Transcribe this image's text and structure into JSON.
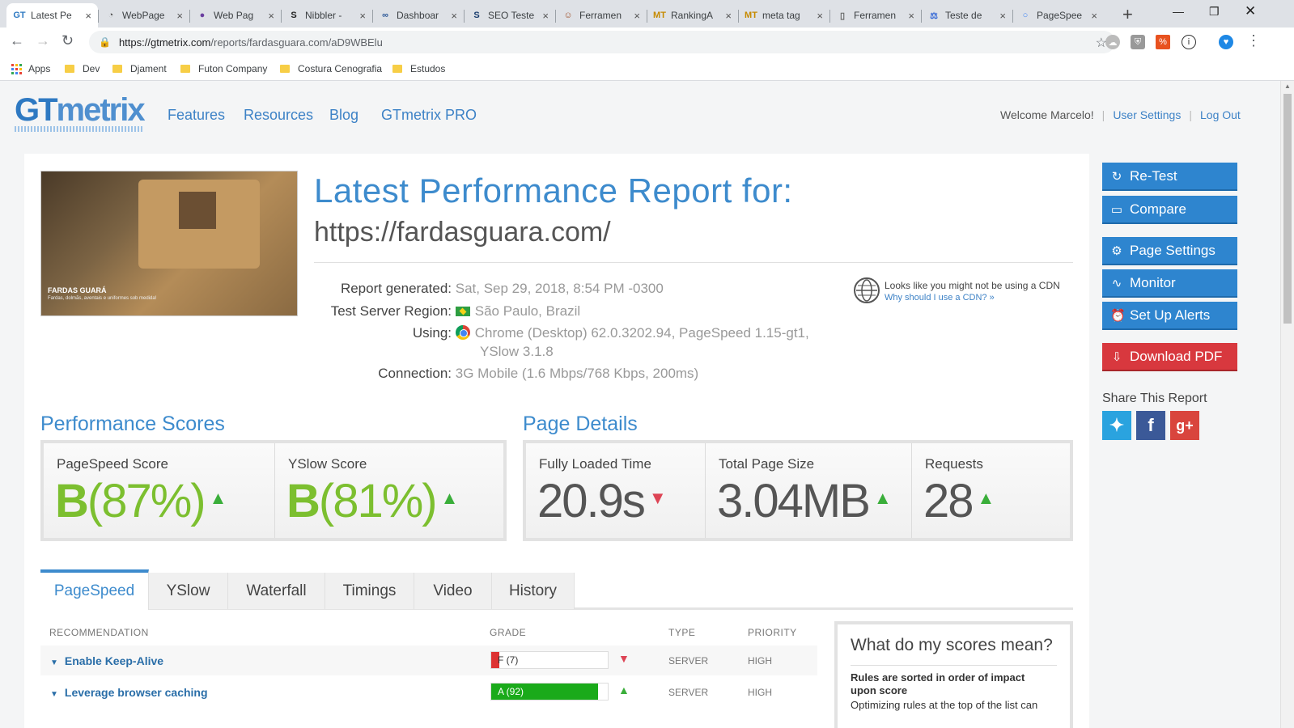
{
  "browser": {
    "tabs": [
      {
        "label": "Latest Pe",
        "favicon": "GT",
        "fav_color": "#2e79c2"
      },
      {
        "label": "WebPage",
        "favicon": "◔",
        "fav_color": "#555"
      },
      {
        "label": "Web Pag",
        "favicon": "●",
        "fav_color": "#6b3fa0"
      },
      {
        "label": "Nibbler -",
        "favicon": "S",
        "fav_color": "#222"
      },
      {
        "label": "Dashboar",
        "favicon": "∞",
        "fav_color": "#2b5797"
      },
      {
        "label": "SEO Teste",
        "favicon": "S",
        "fav_color": "#1a3d6e"
      },
      {
        "label": "Ferramen",
        "favicon": "☺",
        "fav_color": "#a0522d"
      },
      {
        "label": "RankingA",
        "favicon": "MT",
        "fav_color": "#c68a00"
      },
      {
        "label": "meta tag",
        "favicon": "MT",
        "fav_color": "#c68a00"
      },
      {
        "label": "Ferramen",
        "favicon": "▯",
        "fav_color": "#666"
      },
      {
        "label": "Teste de",
        "favicon": "⚖",
        "fav_color": "#3367d6"
      },
      {
        "label": "PageSpee",
        "favicon": "○",
        "fav_color": "#4285f4"
      }
    ],
    "close_glyph": "×",
    "new_tab": "+",
    "url_host": "https://gtmetrix.com",
    "url_path": "/reports/fardasguara.com/aD9WBElu",
    "bookmarks": [
      "Apps",
      "Dev",
      "Djament",
      "Futon Company",
      "Costura Cenografia",
      "Estudos"
    ]
  },
  "header": {
    "logo_gt": "GT",
    "logo_rest": "metrix",
    "nav": [
      "Features",
      "Resources",
      "Blog",
      "GTmetrix PRO"
    ],
    "welcome": "Welcome Marcelo!",
    "user_settings": "User Settings",
    "logout": "Log Out"
  },
  "screenshot": {
    "brand": "FARDAS GUARÁ",
    "tagline": "Fardas, dolmãs, aventais e uniformes sob medida!"
  },
  "report": {
    "title": "Latest Performance Report for:",
    "url": "https://fardasguara.com/",
    "generated_label": "Report generated:",
    "generated_value": "Sat, Sep 29, 2018, 8:54 PM -0300",
    "region_label": "Test Server Region:",
    "region_value": "São Paulo, Brazil",
    "using_label": "Using:",
    "using_value_1": "Chrome (Desktop) 62.0.3202.94, PageSpeed 1.15-gt1,",
    "using_value_2": "YSlow 3.1.8",
    "connection_label": "Connection:",
    "connection_value": "3G Mobile (1.6 Mbps/768 Kbps, 200ms)",
    "cdn_text": "Looks like you might not be using a CDN",
    "cdn_link": "Why should I use a CDN? »"
  },
  "performance": {
    "title": "Performance Scores",
    "pagespeed_label": "PageSpeed Score",
    "pagespeed_grade": "B",
    "pagespeed_pct": "(87%)",
    "yslow_label": "YSlow Score",
    "yslow_grade": "B",
    "yslow_pct": "(81%)"
  },
  "details": {
    "title": "Page Details",
    "loaded_label": "Fully Loaded Time",
    "loaded_value": "20.9s",
    "size_label": "Total Page Size",
    "size_value": "3.04MB",
    "requests_label": "Requests",
    "requests_value": "28"
  },
  "report_tabs": [
    "PageSpeed",
    "YSlow",
    "Waterfall",
    "Timings",
    "Video",
    "History"
  ],
  "table": {
    "headers": [
      "RECOMMENDATION",
      "GRADE",
      "TYPE",
      "PRIORITY"
    ],
    "rows": [
      {
        "name": "Enable Keep-Alive",
        "grade_text": "F (7)",
        "score": 7,
        "color": "#dd3333",
        "trend": "down",
        "type": "SERVER",
        "priority": "HIGH"
      },
      {
        "name": "Leverage browser caching",
        "grade_text": "A (92)",
        "score": 92,
        "color": "#1aaa1a",
        "trend": "up",
        "type": "SERVER",
        "priority": "HIGH"
      }
    ]
  },
  "explain": {
    "title": "What do my scores mean?",
    "bold": "Rules are sorted in order of impact upon score",
    "sub": "Optimizing rules at the top of the list can"
  },
  "sidebar": {
    "retest": "Re-Test",
    "compare": "Compare",
    "page_settings": "Page Settings",
    "monitor": "Monitor",
    "alerts": "Set Up Alerts",
    "download": "Download PDF",
    "share_title": "Share This Report"
  }
}
